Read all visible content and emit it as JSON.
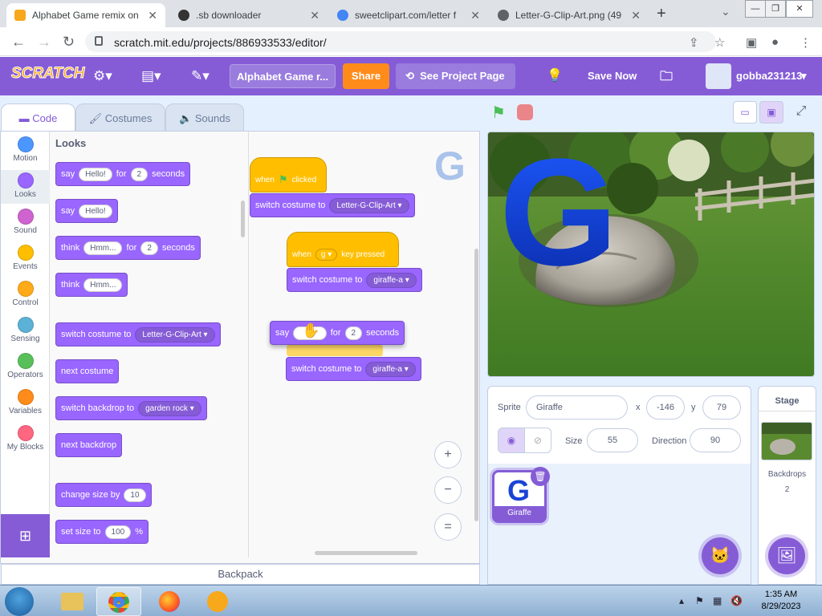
{
  "browser": {
    "tabs": [
      {
        "title": "Alphabet Game remix on",
        "active": true,
        "favicon_color": "#f7a81b"
      },
      {
        "title": ".sb downloader",
        "active": false,
        "favicon_color": "#333333"
      },
      {
        "title": "sweetclipart.com/letter f",
        "active": false,
        "favicon_color": "#4285f4"
      },
      {
        "title": "Letter-G-Clip-Art.png (49",
        "active": false,
        "favicon_color": "#5f6368"
      }
    ],
    "new_tab": "+",
    "url": "scratch.mit.edu/projects/886933533/editor/"
  },
  "menubar": {
    "logo": "SCRATCH",
    "project_title": "Alphabet Game r...",
    "share": "Share",
    "see_project_page": "See Project Page",
    "save_now": "Save Now",
    "username": "gobba231213",
    "accent": "#855cd6"
  },
  "editor_tabs": {
    "code": "Code",
    "costumes": "Costumes",
    "sounds": "Sounds"
  },
  "categories": [
    {
      "label": "Motion",
      "color": "#4c97ff"
    },
    {
      "label": "Looks",
      "color": "#9966ff"
    },
    {
      "label": "Sound",
      "color": "#cf63cf"
    },
    {
      "label": "Events",
      "color": "#ffbf00"
    },
    {
      "label": "Control",
      "color": "#ffab19"
    },
    {
      "label": "Sensing",
      "color": "#5cb1d6"
    },
    {
      "label": "Operators",
      "color": "#59c059"
    },
    {
      "label": "Variables",
      "color": "#ff8c1a"
    },
    {
      "label": "My Blocks",
      "color": "#ff6680"
    }
  ],
  "palette": {
    "title": "Looks",
    "say_for": {
      "say": "say",
      "msg": "Hello!",
      "for": "for",
      "secs": "2",
      "unit": "seconds"
    },
    "say": {
      "say": "say",
      "msg": "Hello!"
    },
    "think_for": {
      "think": "think",
      "msg": "Hmm...",
      "for": "for",
      "secs": "2",
      "unit": "seconds"
    },
    "think": {
      "think": "think",
      "msg": "Hmm..."
    },
    "switch_costume": {
      "text": "switch costume to",
      "value": "Letter-G-Clip-Art"
    },
    "next_costume": "next costume",
    "switch_backdrop": {
      "text": "switch backdrop to",
      "value": "garden rock"
    },
    "next_backdrop": "next backdrop",
    "change_size": {
      "text": "change size by",
      "value": "10"
    },
    "set_size": {
      "text": "set size to",
      "value": "100",
      "unit": "%"
    }
  },
  "script": {
    "hat1": {
      "when": "when",
      "clicked": "clicked"
    },
    "costume1": {
      "text": "switch costume to",
      "value": "Letter-G-Clip-Art"
    },
    "hat2": {
      "when": "when",
      "key": "g",
      "pressed": "key pressed"
    },
    "costume2": {
      "text": "switch costume to",
      "value": "giraffe-a"
    },
    "dragged_say": {
      "say": "say",
      "msg": "Hello!",
      "for": "for",
      "secs": "2",
      "unit": "seconds"
    },
    "costume3": {
      "text": "switch costume to",
      "value": "giraffe-a"
    },
    "sprite_letter": "G"
  },
  "zoom": {
    "in": "+",
    "out": "−",
    "reset": "="
  },
  "backpack": "Backpack",
  "stage": {
    "letter": "G"
  },
  "sprite_info": {
    "sprite_label": "Sprite",
    "sprite_name": "Giraffe",
    "x_label": "x",
    "x": "-146",
    "y_label": "y",
    "y": "79",
    "show_label": "Show",
    "size_label": "Size",
    "size": "55",
    "direction_label": "Direction",
    "direction": "90"
  },
  "sprites": [
    {
      "name": "Giraffe",
      "thumb_letter": "G"
    }
  ],
  "stage_panel": {
    "title": "Stage",
    "backdrops_label": "Backdrops",
    "backdrops_count": "2"
  },
  "taskbar": {
    "time": "1:35 AM",
    "date": "8/29/2023"
  }
}
